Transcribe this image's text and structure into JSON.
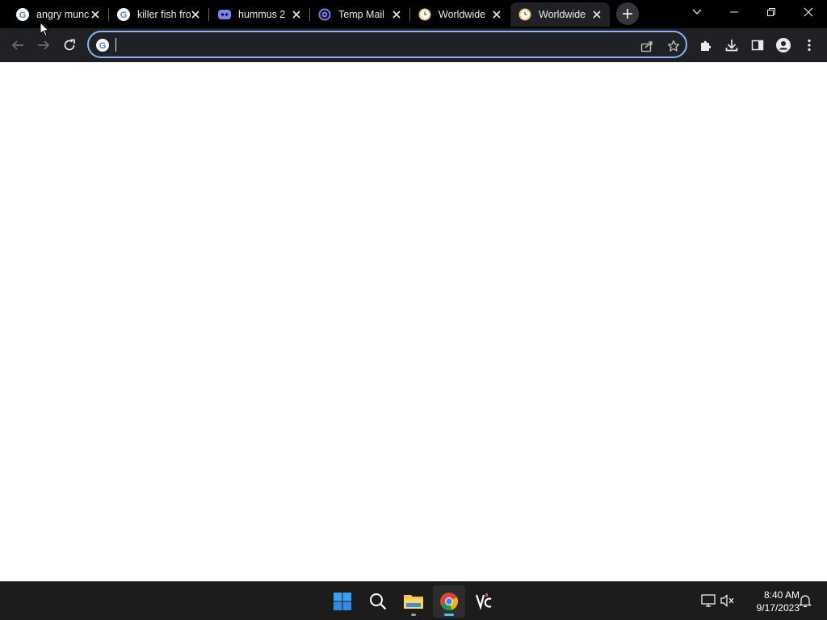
{
  "browser": {
    "tabs": [
      {
        "title": "angry munc",
        "favicon": "google-icon",
        "active": false
      },
      {
        "title": "killer fish fro",
        "favicon": "google-icon",
        "active": false
      },
      {
        "title": "hummus 2",
        "favicon": "discord-icon",
        "active": false
      },
      {
        "title": "Temp Mail",
        "favicon": "at-sign-icon",
        "active": false
      },
      {
        "title": "Worldwide",
        "favicon": "clock-icon",
        "active": false
      },
      {
        "title": "Worldwide",
        "favicon": "clock-icon",
        "active": true
      }
    ],
    "omnibox": {
      "value": "",
      "placeholder": ""
    }
  },
  "taskbar": {
    "apps": [
      "windows-start-icon",
      "search-icon",
      "file-explorer-icon",
      "chrome-icon",
      "app-icon"
    ],
    "time": "8:40 AM",
    "date": "9/17/2023"
  },
  "colors": {
    "accent": "#8ab4f8",
    "toolbar": "#202124",
    "tabstrip": "#000000",
    "taskbar": "#1c1c1c",
    "active_indicator": "#4cc2ff"
  }
}
